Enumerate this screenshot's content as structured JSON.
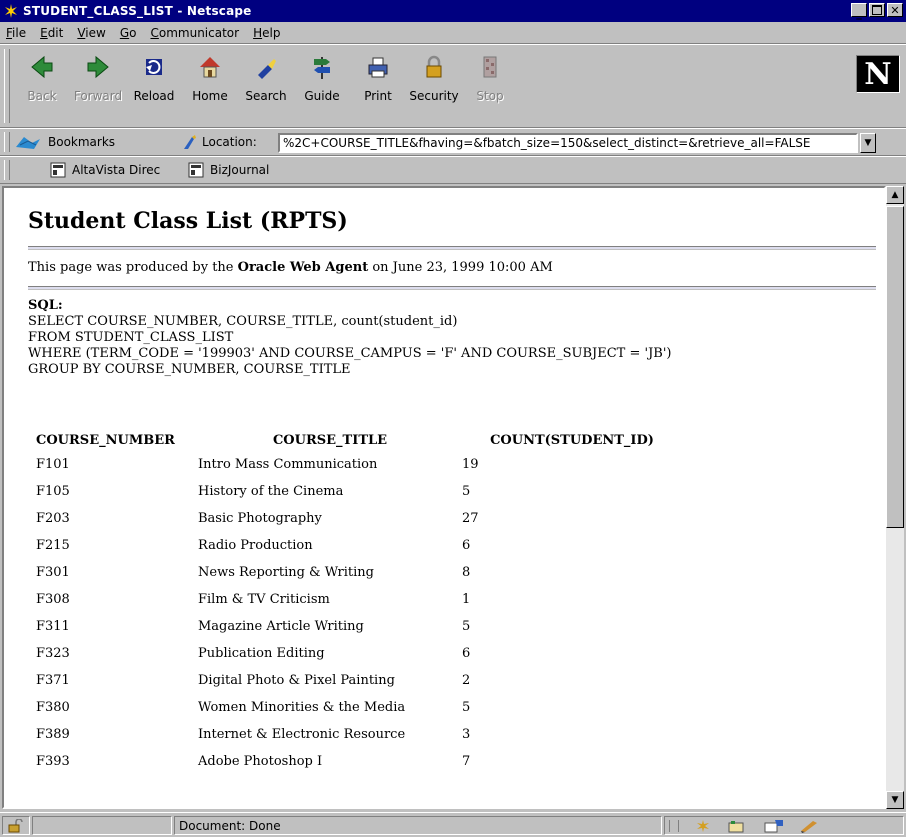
{
  "window": {
    "title": "STUDENT_CLASS_LIST - Netscape"
  },
  "menu": [
    {
      "u": "F",
      "rest": "ile"
    },
    {
      "u": "E",
      "rest": "dit"
    },
    {
      "u": "V",
      "rest": "iew"
    },
    {
      "u": "G",
      "rest": "o"
    },
    {
      "u": "C",
      "rest": "ommunicator"
    },
    {
      "u": "H",
      "rest": "elp"
    }
  ],
  "toolbar": {
    "back": "Back",
    "forward": "Forward",
    "reload": "Reload",
    "home": "Home",
    "search": "Search",
    "guide": "Guide",
    "print": "Print",
    "security": "Security",
    "stop": "Stop",
    "logo": "N"
  },
  "location": {
    "bookmarks_label": "Bookmarks",
    "label": "Location:",
    "url": "%2C+COURSE_TITLE&fhaving=&fbatch_size=150&select_distinct=&retrieve_all=FALSE"
  },
  "personal": [
    "AltaVista Direc",
    "BizJournal"
  ],
  "page": {
    "title": "Student Class List (RPTS)",
    "produced_prefix": "This page was produced by the ",
    "produced_agent": "Oracle Web Agent",
    "produced_suffix": " on June 23, 1999 10:00 AM",
    "sql_heading": "SQL:",
    "sql_lines": [
      "SELECT COURSE_NUMBER, COURSE_TITLE, count(student_id)",
      "FROM STUDENT_CLASS_LIST",
      "WHERE (TERM_CODE = '199903' AND COURSE_CAMPUS = 'F' AND COURSE_SUBJECT = 'JB')",
      "GROUP BY COURSE_NUMBER, COURSE_TITLE"
    ],
    "columns": [
      "COURSE_NUMBER",
      "COURSE_TITLE",
      "COUNT(STUDENT_ID)"
    ],
    "rows": [
      [
        "F101",
        "Intro Mass Communication",
        "19"
      ],
      [
        "F105",
        "History of the Cinema",
        "5"
      ],
      [
        "F203",
        "Basic Photography",
        "27"
      ],
      [
        "F215",
        "Radio Production",
        "6"
      ],
      [
        "F301",
        "News Reporting & Writing",
        "8"
      ],
      [
        "F308",
        "Film & TV Criticism",
        "1"
      ],
      [
        "F311",
        "Magazine Article Writing",
        "5"
      ],
      [
        "F323",
        "Publication Editing",
        "6"
      ],
      [
        "F371",
        "Digital Photo & Pixel Painting",
        "2"
      ],
      [
        "F380",
        "Women Minorities & the Media",
        "5"
      ],
      [
        "F389",
        "Internet & Electronic Resource",
        "3"
      ],
      [
        "F393",
        "Adobe Photoshop I",
        "7"
      ]
    ]
  },
  "status": {
    "text": "Document: Done"
  }
}
